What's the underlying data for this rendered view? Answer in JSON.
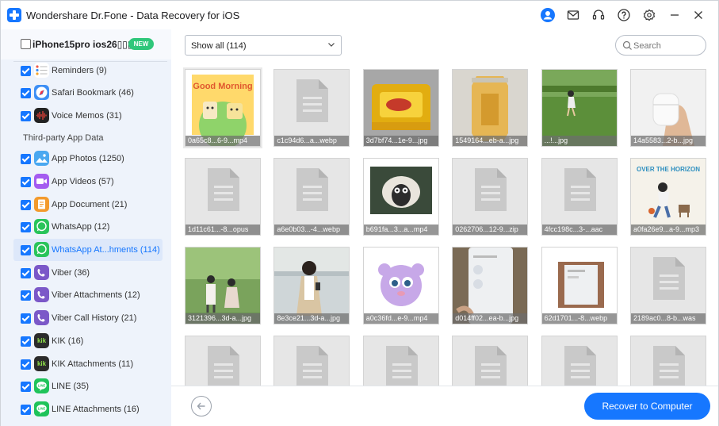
{
  "window": {
    "title": "Wondershare Dr.Fone - Data Recovery for iOS",
    "icons": [
      "user-icon",
      "mail-icon",
      "headset-icon",
      "help-icon",
      "settings-icon",
      "minimize-icon",
      "close-icon"
    ]
  },
  "device": {
    "name": "iPhone15pro ios26▯▯▯",
    "badge": "NEW",
    "checked": false
  },
  "sidebar": {
    "section_label": "Third-party App Data",
    "items": [
      {
        "label": "Reminders (9)",
        "icon": "reminders-icon",
        "color": "#ffffff",
        "checked": true
      },
      {
        "label": "Safari Bookmark (46)",
        "icon": "safari-icon",
        "color": "#3d8ff5",
        "checked": true
      },
      {
        "label": "Voice Memos (31)",
        "icon": "voice-memos-icon",
        "color": "#222222",
        "checked": true
      },
      {
        "label": "App Photos (1250)",
        "icon": "app-photos-icon",
        "color": "#4aa8f0",
        "checked": true
      },
      {
        "label": "App Videos (57)",
        "icon": "app-videos-icon",
        "color": "#a45cf0",
        "checked": true
      },
      {
        "label": "App Document (21)",
        "icon": "app-document-icon",
        "color": "#f39a2c",
        "checked": true
      },
      {
        "label": "WhatsApp (12)",
        "icon": "whatsapp-icon",
        "color": "#29c45a",
        "checked": true
      },
      {
        "label": "WhatsApp At...hments (114)",
        "icon": "whatsapp-icon",
        "color": "#29c45a",
        "checked": true,
        "active": true
      },
      {
        "label": "Viber (36)",
        "icon": "viber-icon",
        "color": "#7b58c8",
        "checked": true
      },
      {
        "label": "Viber Attachments (12)",
        "icon": "viber-icon",
        "color": "#7b58c8",
        "checked": true
      },
      {
        "label": "Viber Call History (21)",
        "icon": "viber-icon",
        "color": "#7b58c8",
        "checked": true
      },
      {
        "label": "KIK (16)",
        "icon": "kik-icon",
        "color": "#2b2b2b",
        "checked": true
      },
      {
        "label": "KIK Attachments (11)",
        "icon": "kik-icon",
        "color": "#2b2b2b",
        "checked": true
      },
      {
        "label": "LINE (35)",
        "icon": "line-icon",
        "color": "#1fc35a",
        "checked": true
      },
      {
        "label": "LINE Attachments (16)",
        "icon": "line-icon",
        "color": "#1fc35a",
        "checked": true
      }
    ]
  },
  "toolbar": {
    "filter_value": "Show all (114)",
    "search_placeholder": "Search"
  },
  "files": [
    {
      "name": "0a65c8...6-9...mp4",
      "kind": "image",
      "subject": "cartoon-good-morning"
    },
    {
      "name": "c1c94d6...a...webp",
      "kind": "document"
    },
    {
      "name": "3d7bf74...1e-9...jpg",
      "kind": "image",
      "subject": "yellow-snack-pack"
    },
    {
      "name": "1549164...eb-a...jpg",
      "kind": "image",
      "subject": "jelly-pack"
    },
    {
      "name": "...!...jpg",
      "kind": "image",
      "subject": "girl-on-grass"
    },
    {
      "name": "14a5583...2-b...jpg",
      "kind": "image",
      "subject": "earbuds-case"
    },
    {
      "name": "1d11c61...-8...opus",
      "kind": "document"
    },
    {
      "name": "a6e0b03...-4...webp",
      "kind": "document"
    },
    {
      "name": "b691fa...3...a...mp4",
      "kind": "image",
      "subject": "sheep-cartoon"
    },
    {
      "name": "0262706...12-9...zip",
      "kind": "document"
    },
    {
      "name": "4fcc198c...3-...aac",
      "kind": "document"
    },
    {
      "name": "a0fa26e9...a-9...mp3",
      "kind": "image",
      "subject": "over-the-horizon"
    },
    {
      "name": "3121396...3d-a...jpg",
      "kind": "image",
      "subject": "couple-park"
    },
    {
      "name": "8e3ce21...3d-a...jpg",
      "kind": "image",
      "subject": "woman-phone"
    },
    {
      "name": "a0c36fd...e-9...mp4",
      "kind": "image",
      "subject": "purple-creature"
    },
    {
      "name": "d014ff02...ea-b...jpg",
      "kind": "image",
      "subject": "phone-screen"
    },
    {
      "name": "62d1701...-8...webp",
      "kind": "image",
      "subject": "phone-screen-small"
    },
    {
      "name": "2189ac0...8-b...was",
      "kind": "document"
    },
    {
      "name": "",
      "kind": "document"
    },
    {
      "name": "",
      "kind": "document"
    },
    {
      "name": "",
      "kind": "document"
    },
    {
      "name": "",
      "kind": "document"
    },
    {
      "name": "",
      "kind": "document"
    },
    {
      "name": "",
      "kind": "document"
    }
  ],
  "footer": {
    "recover_label": "Recover to Computer"
  },
  "colors": {
    "accent": "#1677ff",
    "sidebar_bg": "#eef3fb",
    "active_item_bg": "#dde8fa",
    "new_badge": "#2fc77a"
  }
}
